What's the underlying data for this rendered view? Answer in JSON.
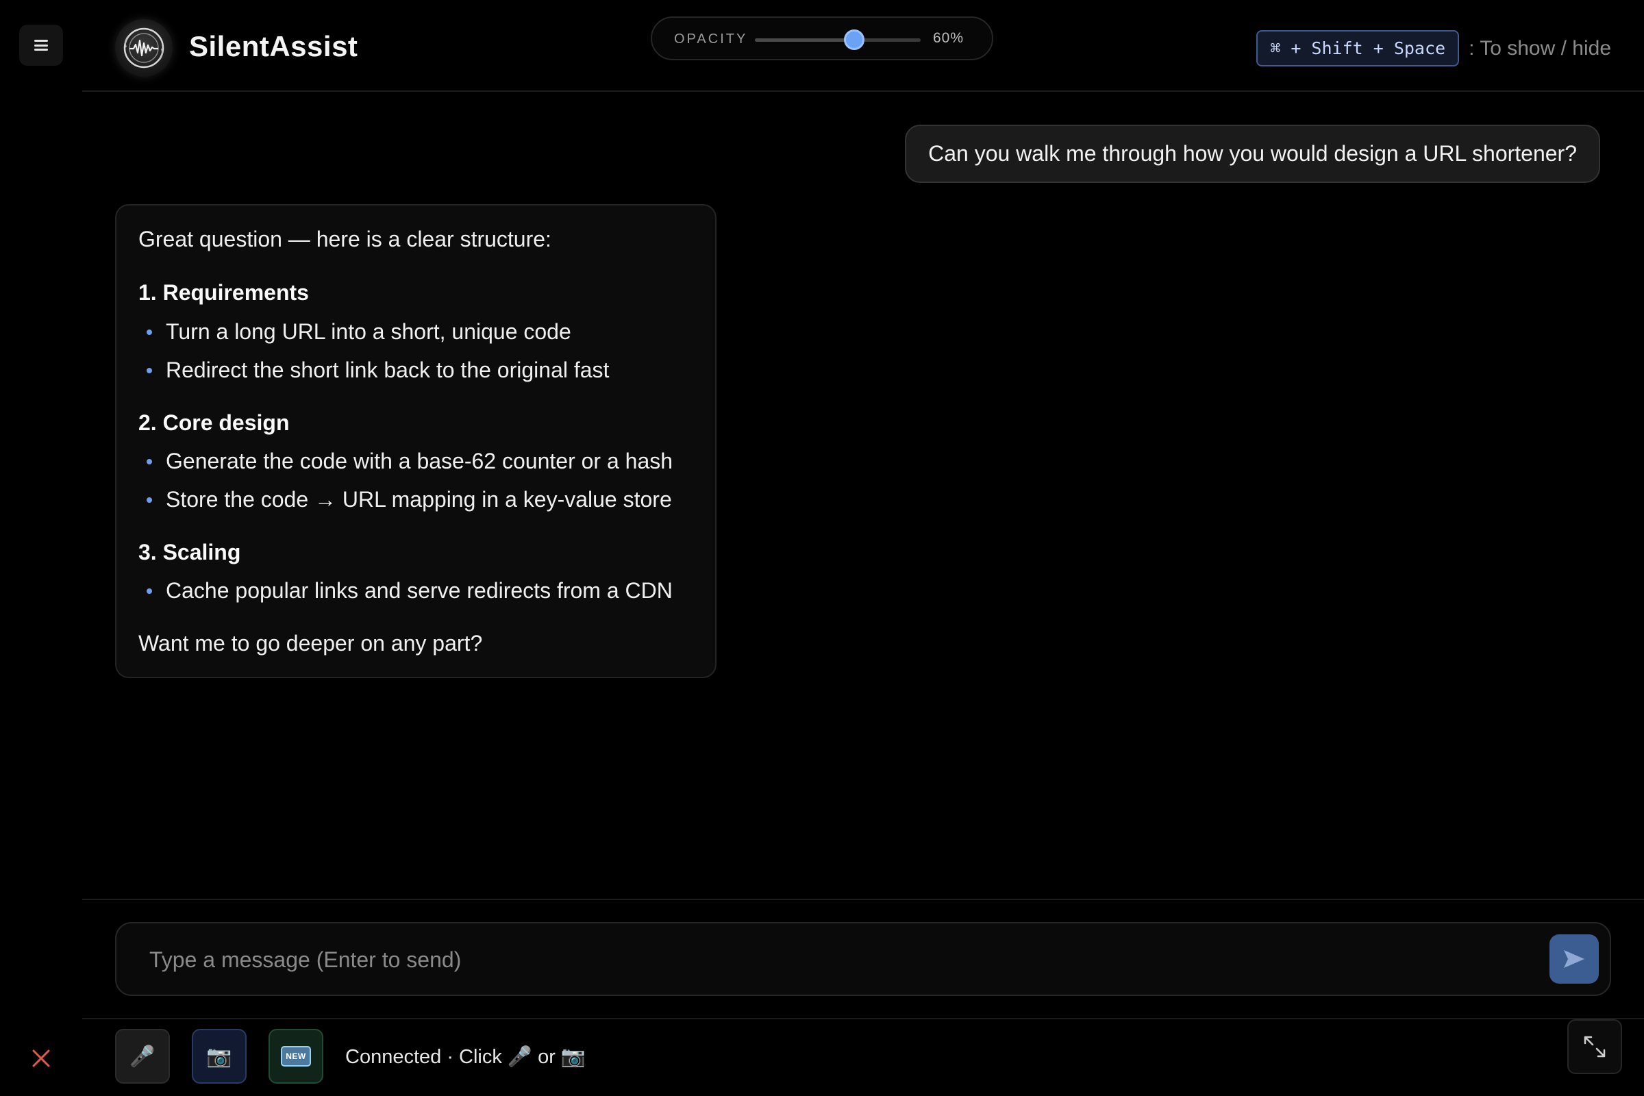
{
  "app": {
    "name": "SilentAssist"
  },
  "opacity": {
    "label": "OPACITY",
    "value_text": "60%",
    "value": 0.6
  },
  "shortcut": {
    "keys": "⌘ + Shift + Space",
    "hint": ": To show / hide"
  },
  "messages": {
    "user": "Can you walk me through how you would design a URL shortener?",
    "assistant": {
      "intro": "Great question — here is a clear structure:",
      "sections": [
        {
          "heading": "1. Requirements",
          "items": [
            "Turn a long URL into a short, unique code",
            "Redirect the short link back to the original fast"
          ]
        },
        {
          "heading": "2. Core design",
          "items": [
            "Generate the code with a base-62 counter or a hash",
            "Store the code → URL mapping in a key-value store"
          ]
        },
        {
          "heading": "3. Scaling",
          "items": [
            "Cache popular links and serve redirects from a CDN"
          ]
        }
      ],
      "outro": "Want me to go deeper on any part?"
    }
  },
  "composer": {
    "placeholder": "Type a message (Enter to send)"
  },
  "toolbar": {
    "mic_icon": "🎤",
    "camera_icon": "📷",
    "new_badge": "NEW",
    "status": "Connected · Click 🎤 or 📷"
  },
  "colors": {
    "accent": "#6aa3f5",
    "send_button": "#3c5d91",
    "close_icon": "#e05a4f"
  },
  "icons": {
    "menu": "menu-icon",
    "close": "close-icon",
    "send": "send-icon",
    "expand": "expand-icon",
    "logo": "waveform-logo-icon"
  }
}
